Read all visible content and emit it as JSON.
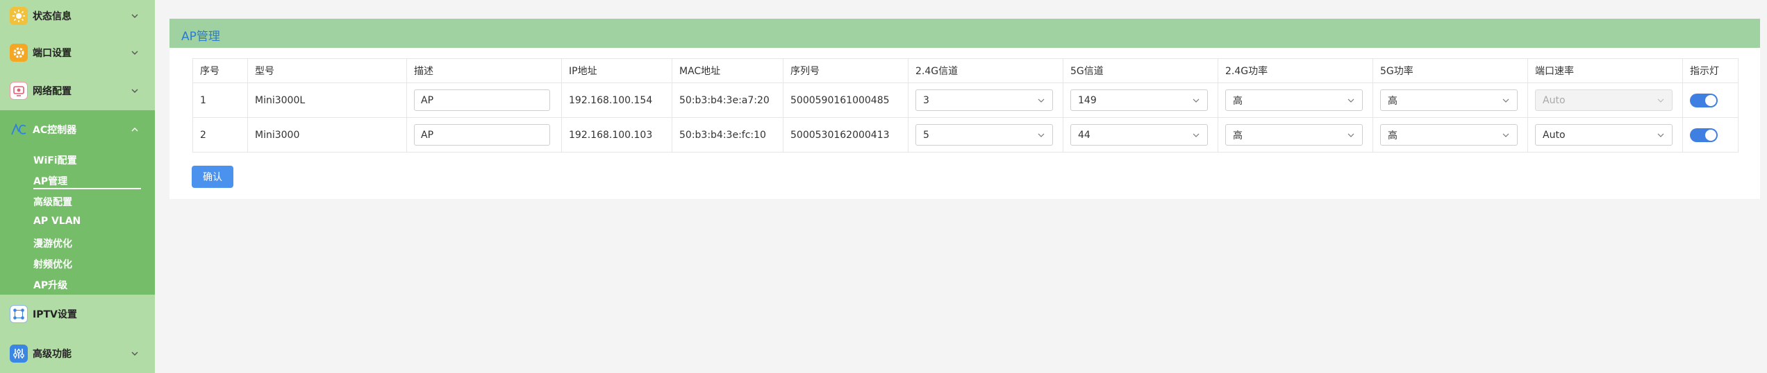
{
  "sidebar": {
    "menu": {
      "status": "状态信息",
      "port": "端口设置",
      "network": "网络配置",
      "ac": "AC控制器",
      "iptv": "IPTV设置",
      "advanced": "高级功能"
    },
    "ac_submenu": [
      "WiFi配置",
      "AP管理",
      "高级配置",
      "AP VLAN",
      "漫游优化",
      "射频优化",
      "AP升级"
    ],
    "active_sub": "AP管理"
  },
  "panel": {
    "title": "AP管理",
    "confirm_label": "确认"
  },
  "table": {
    "columns": [
      "序号",
      "型号",
      "描述",
      "IP地址",
      "MAC地址",
      "序列号",
      "2.4G信道",
      "5G信道",
      "2.4G功率",
      "5G功率",
      "端口速率",
      "指示灯"
    ],
    "rows": [
      {
        "index": "1",
        "model": "Mini3000L",
        "desc": "AP",
        "ip": "192.168.100.154",
        "mac": "50:b3:b4:3e:a7:20",
        "serial": "5000590161000485",
        "ch24": "3",
        "ch5": "149",
        "pw24": "高",
        "pw5": "高",
        "port_speed": "Auto",
        "port_speed_disabled": true,
        "led_on": true
      },
      {
        "index": "2",
        "model": "Mini3000",
        "desc": "AP",
        "ip": "192.168.100.103",
        "mac": "50:b3:b4:3e:fc:10",
        "serial": "5000530162000413",
        "ch24": "5",
        "ch5": "44",
        "pw24": "高",
        "pw5": "高",
        "port_speed": "Auto",
        "port_speed_disabled": false,
        "led_on": true
      }
    ]
  },
  "colors": {
    "sidebar_bg": "#b2dca5",
    "sidebar_active_bg": "#76bd69",
    "panel_header_bg": "#9fd2a0",
    "title_color": "#2a7bd1",
    "accent": "#4b92ee",
    "toggle_on": "#3e7fe1"
  }
}
